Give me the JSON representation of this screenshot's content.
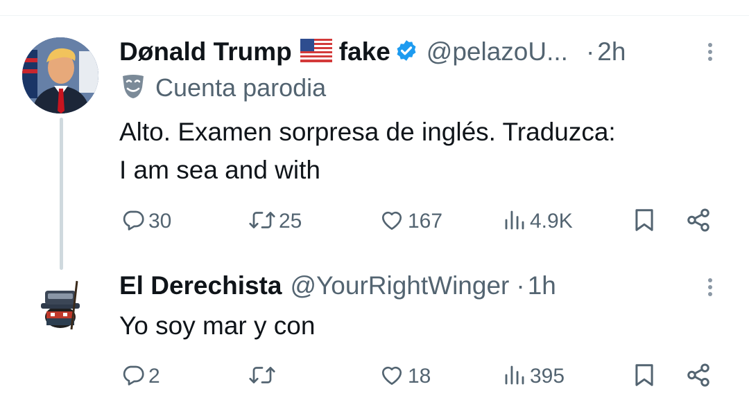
{
  "tweets": [
    {
      "display_name": "Dønald Trump",
      "flag": "🇺🇸",
      "suffix": "fake",
      "handle": "@pelazoU...",
      "dot": "·",
      "time": "2h",
      "label": "Cuenta parodia",
      "text_lines": [
        "Alto. Examen sorpresa de inglés. Traduzca:",
        "I am sea and with"
      ],
      "replies": "30",
      "reposts": "25",
      "likes": "167",
      "views": "4.9K"
    },
    {
      "display_name": "El Derechista",
      "handle": "@YourRightWinger",
      "dot": "·",
      "time": "1h",
      "text_lines": [
        "Yo soy mar y con"
      ],
      "replies": "2",
      "reposts": "",
      "likes": "18",
      "views": "395"
    }
  ],
  "icons": {
    "reply": "reply-icon",
    "repost": "repost-icon",
    "like": "heart-icon",
    "views": "views-icon",
    "bookmark": "bookmark-icon",
    "share": "share-icon",
    "more": "more-icon",
    "verified": "verified-badge-icon",
    "parody": "parody-mask-icon"
  },
  "colors": {
    "text": "#0f1419",
    "secondary": "#536471",
    "verified": "#1d9bf0",
    "thread_line": "#cfd9de"
  }
}
